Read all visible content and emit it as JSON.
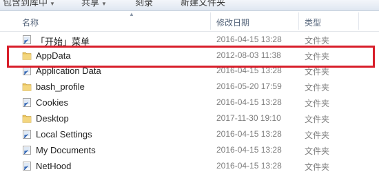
{
  "toolbar": {
    "items": [
      {
        "label": "包含到库中",
        "has_dropdown": true
      },
      {
        "label": "共享",
        "has_dropdown": true
      },
      {
        "label": "刻录",
        "has_dropdown": false
      },
      {
        "label": "新建文件夹",
        "has_dropdown": false
      }
    ]
  },
  "columns": {
    "name": "名称",
    "date": "修改日期",
    "type": "类型"
  },
  "rows": [
    {
      "name": "「开始」菜单",
      "date": "2016-04-15 13:28",
      "type": "文件夹",
      "icon": "shortcut-folder-icon"
    },
    {
      "name": "AppData",
      "date": "2012-08-03 11:38",
      "type": "文件夹",
      "icon": "folder-icon",
      "highlighted": true
    },
    {
      "name": "Application Data",
      "date": "2016-04-15 13:28",
      "type": "文件夹",
      "icon": "shortcut-folder-icon"
    },
    {
      "name": "bash_profile",
      "date": "2016-05-20 17:59",
      "type": "文件夹",
      "icon": "folder-icon"
    },
    {
      "name": "Cookies",
      "date": "2016-04-15 13:28",
      "type": "文件夹",
      "icon": "shortcut-folder-icon"
    },
    {
      "name": "Desktop",
      "date": "2017-11-30 19:10",
      "type": "文件夹",
      "icon": "folder-icon"
    },
    {
      "name": "Local Settings",
      "date": "2016-04-15 13:28",
      "type": "文件夹",
      "icon": "shortcut-folder-icon"
    },
    {
      "name": "My Documents",
      "date": "2016-04-15 13:28",
      "type": "文件夹",
      "icon": "shortcut-folder-icon"
    },
    {
      "name": "NetHood",
      "date": "2016-04-15 13:28",
      "type": "文件夹",
      "icon": "shortcut-folder-icon"
    }
  ],
  "colors": {
    "highlight_border": "#d81e2a",
    "folder": "#e9c25a",
    "muted_text": "#7d7d7d"
  }
}
